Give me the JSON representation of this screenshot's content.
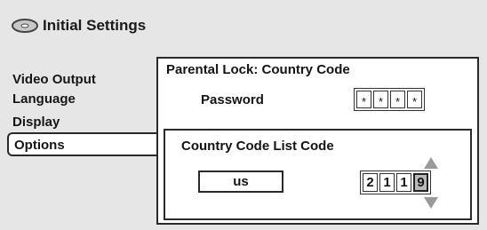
{
  "header": {
    "title": "Initial Settings",
    "icon": "disc-icon"
  },
  "sidebar": {
    "items": [
      {
        "label": "Video Output",
        "selected": false
      },
      {
        "label": "Language",
        "selected": false
      },
      {
        "label": "Display",
        "selected": false
      },
      {
        "label": "Options",
        "selected": true
      }
    ]
  },
  "panel": {
    "title": "Parental Lock: Country Code",
    "password_label": "Password",
    "password_chars": [
      "*",
      "*",
      "*",
      "*"
    ],
    "country": {
      "title": "Country Code List Code",
      "value": "us",
      "code_digits": [
        "2",
        "1",
        "1",
        "9"
      ],
      "active_digit_index": 3
    }
  },
  "colors": {
    "background": "#e6e6e6",
    "panel": "#ffffff",
    "border": "#2a2a2a",
    "active_digit": "#b9b9b9",
    "arrow": "#9a9a9a"
  }
}
